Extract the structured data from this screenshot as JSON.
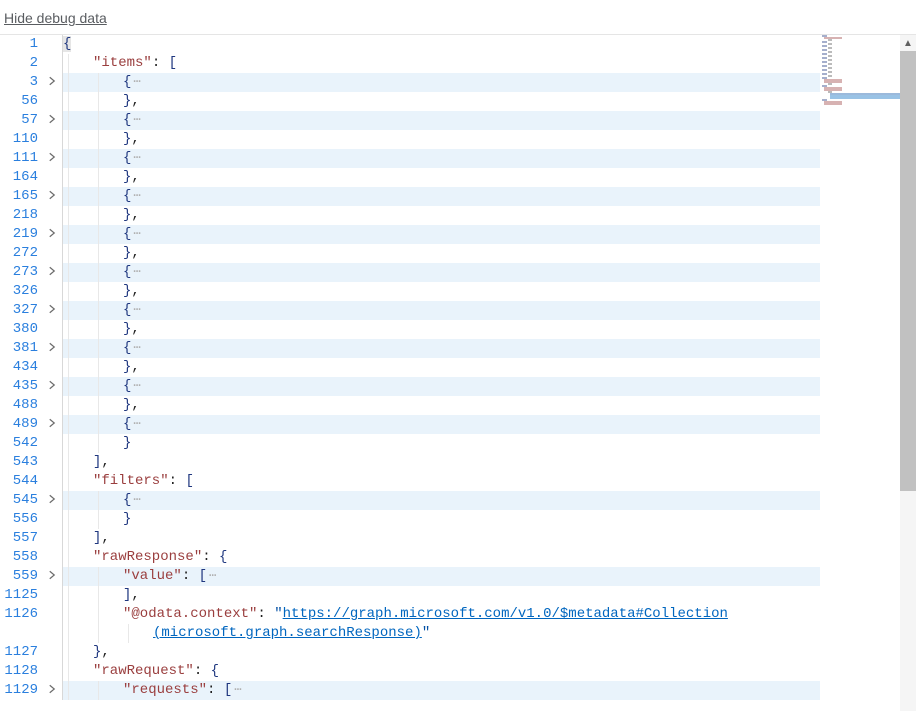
{
  "header": {
    "link": "Hide debug data"
  },
  "lines": [
    {
      "ln": 1,
      "fold": false,
      "hl": false,
      "i": 0,
      "segs": [
        {
          "t": "brace-hl",
          "v": "{"
        }
      ]
    },
    {
      "ln": 2,
      "fold": false,
      "hl": false,
      "i": 1,
      "segs": [
        {
          "t": "key",
          "v": "\"items\""
        },
        {
          "t": "punct",
          "v": ": "
        },
        {
          "t": "brace",
          "v": "["
        }
      ]
    },
    {
      "ln": 3,
      "fold": true,
      "hl": true,
      "i": 2,
      "segs": [
        {
          "t": "brace",
          "v": "{"
        },
        {
          "t": "ell",
          "v": "⋯"
        }
      ]
    },
    {
      "ln": 56,
      "fold": false,
      "hl": false,
      "i": 2,
      "segs": [
        {
          "t": "brace",
          "v": "}"
        },
        {
          "t": "punct",
          "v": ","
        }
      ]
    },
    {
      "ln": 57,
      "fold": true,
      "hl": true,
      "i": 2,
      "segs": [
        {
          "t": "brace",
          "v": "{"
        },
        {
          "t": "ell",
          "v": "⋯"
        }
      ]
    },
    {
      "ln": 110,
      "fold": false,
      "hl": false,
      "i": 2,
      "segs": [
        {
          "t": "brace",
          "v": "}"
        },
        {
          "t": "punct",
          "v": ","
        }
      ]
    },
    {
      "ln": 111,
      "fold": true,
      "hl": true,
      "i": 2,
      "segs": [
        {
          "t": "brace",
          "v": "{"
        },
        {
          "t": "ell",
          "v": "⋯"
        }
      ]
    },
    {
      "ln": 164,
      "fold": false,
      "hl": false,
      "i": 2,
      "segs": [
        {
          "t": "brace",
          "v": "}"
        },
        {
          "t": "punct",
          "v": ","
        }
      ]
    },
    {
      "ln": 165,
      "fold": true,
      "hl": true,
      "i": 2,
      "segs": [
        {
          "t": "brace",
          "v": "{"
        },
        {
          "t": "ell",
          "v": "⋯"
        }
      ]
    },
    {
      "ln": 218,
      "fold": false,
      "hl": false,
      "i": 2,
      "segs": [
        {
          "t": "brace",
          "v": "}"
        },
        {
          "t": "punct",
          "v": ","
        }
      ]
    },
    {
      "ln": 219,
      "fold": true,
      "hl": true,
      "i": 2,
      "segs": [
        {
          "t": "brace",
          "v": "{"
        },
        {
          "t": "ell",
          "v": "⋯"
        }
      ]
    },
    {
      "ln": 272,
      "fold": false,
      "hl": false,
      "i": 2,
      "segs": [
        {
          "t": "brace",
          "v": "}"
        },
        {
          "t": "punct",
          "v": ","
        }
      ]
    },
    {
      "ln": 273,
      "fold": true,
      "hl": true,
      "i": 2,
      "segs": [
        {
          "t": "brace",
          "v": "{"
        },
        {
          "t": "ell",
          "v": "⋯"
        }
      ]
    },
    {
      "ln": 326,
      "fold": false,
      "hl": false,
      "i": 2,
      "segs": [
        {
          "t": "brace",
          "v": "}"
        },
        {
          "t": "punct",
          "v": ","
        }
      ]
    },
    {
      "ln": 327,
      "fold": true,
      "hl": true,
      "i": 2,
      "segs": [
        {
          "t": "brace",
          "v": "{"
        },
        {
          "t": "ell",
          "v": "⋯"
        }
      ]
    },
    {
      "ln": 380,
      "fold": false,
      "hl": false,
      "i": 2,
      "segs": [
        {
          "t": "brace",
          "v": "}"
        },
        {
          "t": "punct",
          "v": ","
        }
      ]
    },
    {
      "ln": 381,
      "fold": true,
      "hl": true,
      "i": 2,
      "segs": [
        {
          "t": "brace",
          "v": "{"
        },
        {
          "t": "ell",
          "v": "⋯"
        }
      ]
    },
    {
      "ln": 434,
      "fold": false,
      "hl": false,
      "i": 2,
      "segs": [
        {
          "t": "brace",
          "v": "}"
        },
        {
          "t": "punct",
          "v": ","
        }
      ]
    },
    {
      "ln": 435,
      "fold": true,
      "hl": true,
      "i": 2,
      "segs": [
        {
          "t": "brace",
          "v": "{"
        },
        {
          "t": "ell",
          "v": "⋯"
        }
      ]
    },
    {
      "ln": 488,
      "fold": false,
      "hl": false,
      "i": 2,
      "segs": [
        {
          "t": "brace",
          "v": "}"
        },
        {
          "t": "punct",
          "v": ","
        }
      ]
    },
    {
      "ln": 489,
      "fold": true,
      "hl": true,
      "i": 2,
      "segs": [
        {
          "t": "brace",
          "v": "{"
        },
        {
          "t": "ell",
          "v": "⋯"
        }
      ]
    },
    {
      "ln": 542,
      "fold": false,
      "hl": false,
      "i": 2,
      "segs": [
        {
          "t": "brace",
          "v": "}"
        }
      ]
    },
    {
      "ln": 543,
      "fold": false,
      "hl": false,
      "i": 1,
      "segs": [
        {
          "t": "brace",
          "v": "]"
        },
        {
          "t": "punct",
          "v": ","
        }
      ]
    },
    {
      "ln": 544,
      "fold": false,
      "hl": false,
      "i": 1,
      "segs": [
        {
          "t": "key",
          "v": "\"filters\""
        },
        {
          "t": "punct",
          "v": ": "
        },
        {
          "t": "brace",
          "v": "["
        }
      ]
    },
    {
      "ln": 545,
      "fold": true,
      "hl": true,
      "i": 2,
      "segs": [
        {
          "t": "brace",
          "v": "{"
        },
        {
          "t": "ell",
          "v": "⋯"
        }
      ]
    },
    {
      "ln": 556,
      "fold": false,
      "hl": false,
      "i": 2,
      "segs": [
        {
          "t": "brace",
          "v": "}"
        }
      ]
    },
    {
      "ln": 557,
      "fold": false,
      "hl": false,
      "i": 1,
      "segs": [
        {
          "t": "brace",
          "v": "]"
        },
        {
          "t": "punct",
          "v": ","
        }
      ]
    },
    {
      "ln": 558,
      "fold": false,
      "hl": false,
      "i": 1,
      "segs": [
        {
          "t": "key",
          "v": "\"rawResponse\""
        },
        {
          "t": "punct",
          "v": ": "
        },
        {
          "t": "brace",
          "v": "{"
        }
      ]
    },
    {
      "ln": 559,
      "fold": true,
      "hl": true,
      "i": 2,
      "segs": [
        {
          "t": "key",
          "v": "\"value\""
        },
        {
          "t": "punct",
          "v": ": "
        },
        {
          "t": "brace",
          "v": "["
        },
        {
          "t": "ell",
          "v": "⋯"
        }
      ]
    },
    {
      "ln": 1125,
      "fold": false,
      "hl": false,
      "i": 2,
      "segs": [
        {
          "t": "brace",
          "v": "]"
        },
        {
          "t": "punct",
          "v": ","
        }
      ]
    },
    {
      "ln": 1126,
      "fold": false,
      "hl": false,
      "i": 2,
      "wrap": true,
      "segs": [
        {
          "t": "key",
          "v": "\"@odata.context\""
        },
        {
          "t": "punct",
          "v": ": "
        },
        {
          "t": "str",
          "v": "\""
        },
        {
          "t": "link",
          "v": "https://graph.microsoft.com/v1.0/$metadata#Collection"
        }
      ],
      "wrapSegs": [
        {
          "t": "link",
          "v": "(microsoft.graph.searchResponse)"
        },
        {
          "t": "str",
          "v": "\""
        }
      ]
    },
    {
      "ln": 1127,
      "fold": false,
      "hl": false,
      "i": 1,
      "segs": [
        {
          "t": "brace",
          "v": "}"
        },
        {
          "t": "punct",
          "v": ","
        }
      ]
    },
    {
      "ln": 1128,
      "fold": false,
      "hl": false,
      "i": 1,
      "segs": [
        {
          "t": "key",
          "v": "\"rawRequest\""
        },
        {
          "t": "punct",
          "v": ": "
        },
        {
          "t": "brace",
          "v": "{"
        }
      ]
    },
    {
      "ln": 1129,
      "fold": true,
      "hl": true,
      "i": 2,
      "segs": [
        {
          "t": "key",
          "v": "\"requests\""
        },
        {
          "t": "punct",
          "v": ": "
        },
        {
          "t": "brace",
          "v": "["
        },
        {
          "t": "ell",
          "v": "⋯"
        }
      ]
    }
  ]
}
